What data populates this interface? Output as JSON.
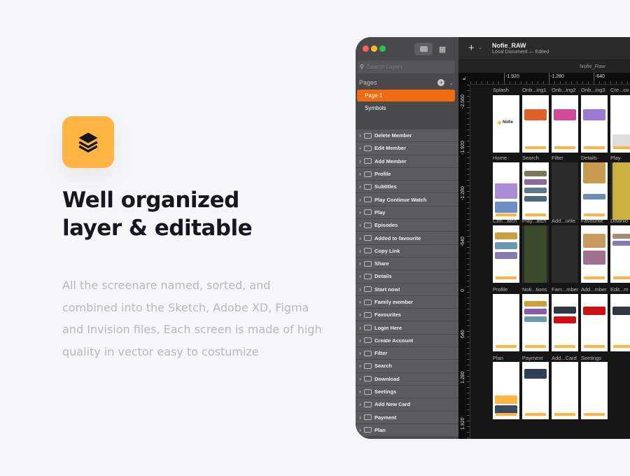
{
  "hero": {
    "icon": "layers-icon",
    "accent": "#ffb443",
    "headline_line1": "Well organized",
    "headline_line2": "layer & editable",
    "body": "All the screenare named, sorted, and combined into the Sketch, Adobe XD, Figma and Invision files, Each screen is made of high quality in vector easy to costumize"
  },
  "sidebar": {
    "search_placeholder": "Search Layers",
    "pages_label": "Pages",
    "pages": [
      {
        "label": "Page 1",
        "selected": true
      },
      {
        "label": "Symbols",
        "selected": false
      }
    ],
    "selected_color": "#f06a0f",
    "layers": [
      "Delete Member",
      "Edit Member",
      "Add Member",
      "Profile",
      "Subtitles",
      "Play Continue Watch",
      "Play",
      "Episodes",
      "Added to favourite",
      "Copy Link",
      "Share",
      "Details",
      "Start now!",
      "Family member",
      "Favourites",
      "Login Here",
      "Create Account",
      "Filter",
      "Search",
      "Download",
      "Seetings",
      "Add New Card",
      "Payment",
      "Plan"
    ]
  },
  "document": {
    "title": "Nofie_RAW",
    "subtitle": "Local Document — Edited",
    "tab": "Nofie_Raw",
    "splash_logo": "Nofie"
  },
  "rulers": {
    "top": [
      "-1.920",
      "-1.280",
      "-640"
    ],
    "left": [
      "-2.560",
      "-1.920",
      "-1.280",
      "-640",
      "0",
      "640",
      "1.280",
      "1.920"
    ]
  },
  "artboards": [
    [
      "Splash",
      "Onb...ing1",
      "Onb...ing2",
      "Onb...ing3",
      "Cre...co"
    ],
    [
      "Home",
      "Search",
      "Filter",
      "Details",
      "Play"
    ],
    [
      "Con...atch",
      "Play...atch",
      "Add...urite",
      "Favourite",
      "Downlo"
    ],
    [
      "Profile",
      "Noti...tions",
      "Fam...mber",
      "Add...mber",
      "Edit...m"
    ],
    [
      "Plan",
      "Payment",
      "Add...Card",
      "Seetings"
    ]
  ]
}
